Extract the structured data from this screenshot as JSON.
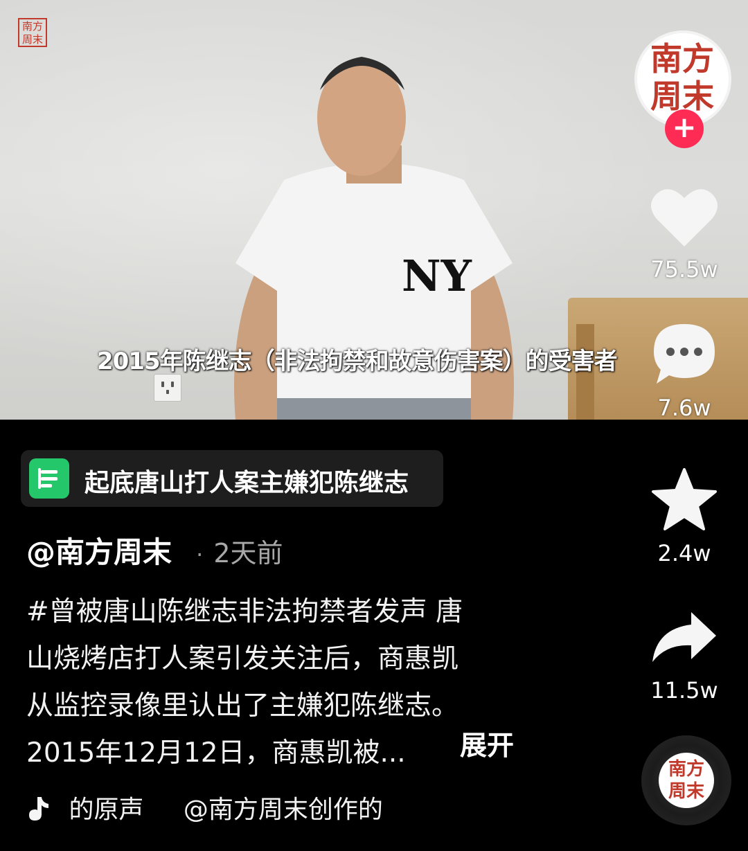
{
  "video": {
    "watermark": "南方周末",
    "caption": "2015年陈继志（非法拘禁和故意伤害案）的受害者"
  },
  "rail": {
    "avatar_text": "南方周末",
    "follow_symbol": "+",
    "likes": "75.5w",
    "comments": "7.6w",
    "favorites": "2.4w",
    "shares": "11.5w"
  },
  "topic": {
    "label": "起底唐山打人案主嫌犯陈继志"
  },
  "post": {
    "author": "@南方周末",
    "separator": "·",
    "time": "2天前",
    "description_lines": [
      "#曾被唐山陈继志非法拘禁者发声 唐",
      "山烧烤店打人案引发关注后，商惠凯",
      "从监控录像里认出了主嫌犯陈继志。",
      "2015年12月12日，商惠凯被..."
    ],
    "expand": "展开"
  },
  "music": {
    "label": "的原声",
    "credit": "@南方周末创作的"
  },
  "colors": {
    "accent": "#fe2c55",
    "topic_green": "#25c76b",
    "seal_red": "#c0392b"
  },
  "icons": [
    "heart-icon",
    "comment-icon",
    "star-icon",
    "share-icon",
    "music-note-icon",
    "doc-icon"
  ]
}
